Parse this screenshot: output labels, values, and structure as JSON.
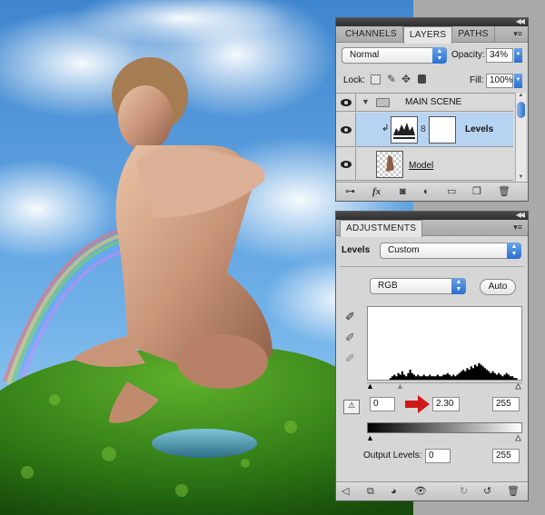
{
  "layers_panel": {
    "tabs": [
      "CHANNELS",
      "LAYERS",
      "PATHS"
    ],
    "active_tab": "LAYERS",
    "blend_mode": "Normal",
    "opacity_label": "Opacity:",
    "opacity_value": "34%",
    "lock_label": "Lock:",
    "fill_label": "Fill:",
    "fill_value": "100%",
    "layers": [
      {
        "name": "MAIN SCENE",
        "type": "group"
      },
      {
        "name": "Levels",
        "type": "adjustment",
        "selected": true
      },
      {
        "name": "Model",
        "type": "pixel"
      }
    ],
    "footer_icons": [
      "link-icon",
      "fx-icon",
      "mask-icon",
      "adjustment-icon",
      "folder-icon",
      "new-layer-icon",
      "trash-icon"
    ],
    "fx_label": "fx"
  },
  "adjustments_panel": {
    "tab": "ADJUSTMENTS",
    "title_label": "Levels",
    "preset_value": "Custom",
    "channel_value": "RGB",
    "auto_label": "Auto",
    "input_black": "0",
    "input_gamma": "2.30",
    "input_white": "255",
    "output_label": "Output Levels:",
    "output_black": "0",
    "output_white": "255",
    "histogram_levels": [
      0,
      0,
      0,
      0,
      0,
      0,
      0,
      0,
      0,
      0,
      0,
      1,
      2,
      3,
      2,
      4,
      3,
      5,
      3,
      2,
      4,
      6,
      4,
      3,
      2,
      3,
      2,
      2,
      3,
      2,
      2,
      3,
      2,
      2,
      2,
      3,
      2,
      2,
      3,
      3,
      4,
      3,
      2,
      3,
      2,
      3,
      4,
      5,
      6,
      5,
      7,
      6,
      8,
      7,
      9,
      8,
      10,
      9,
      8,
      7,
      6,
      5,
      4,
      5,
      4,
      3,
      4,
      3,
      2,
      3,
      4,
      3,
      2,
      2,
      1,
      1,
      0,
      0
    ],
    "footer_icons": [
      "back-icon",
      "clip-icon",
      "mask-view-icon",
      "eye-icon",
      "previous-state-icon",
      "reset-icon",
      "trash-icon"
    ]
  },
  "colors": {
    "panel_bg": "#d6d6d6",
    "selection_blue": "#b7d3f2",
    "accent_blue": "#2a6fd0",
    "arrow_red": "#d01818"
  }
}
